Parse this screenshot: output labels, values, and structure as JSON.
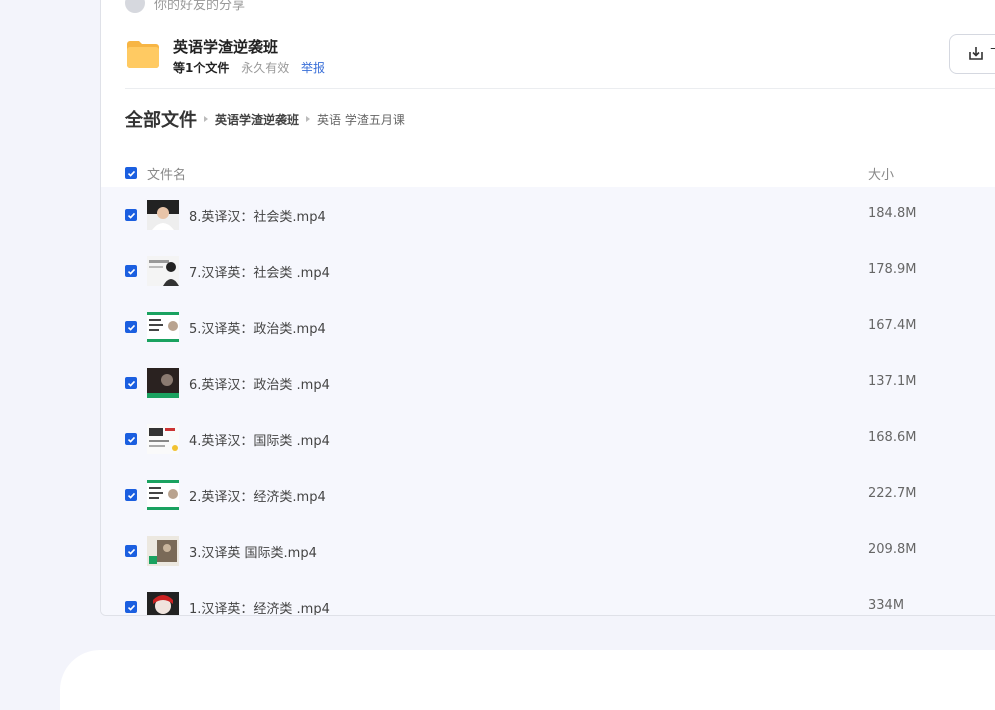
{
  "share": {
    "sharer_text": "你的好友的分享",
    "folder_name": "英语学渣逆袭班",
    "file_count": "等1个文件",
    "validity": "永久有效",
    "report": "举报",
    "download_label": "下"
  },
  "breadcrumb": {
    "root": "全部文件",
    "level1": "英语学渣逆袭班",
    "level2": "英语 学渣五月课"
  },
  "table": {
    "col_name": "文件名",
    "col_size": "大小"
  },
  "files": [
    {
      "name": "8.英译汉：社会类.mp4",
      "size": "184.8M",
      "thumb": "person-dark"
    },
    {
      "name": "7.汉译英：社会类 .mp4",
      "size": "178.9M",
      "thumb": "person-light"
    },
    {
      "name": "5.汉译英：政治类.mp4",
      "size": "167.4M",
      "thumb": "slide-green"
    },
    {
      "name": "6.英译汉：政治类 .mp4",
      "size": "137.1M",
      "thumb": "dark-green-bar"
    },
    {
      "name": "4.英译汉：国际类 .mp4",
      "size": "168.6M",
      "thumb": "doc-light"
    },
    {
      "name": "2.英译汉：经济类.mp4",
      "size": "222.7M",
      "thumb": "slide-green"
    },
    {
      "name": "3.汉译英 国际类.mp4",
      "size": "209.8M",
      "thumb": "photo-mixed"
    },
    {
      "name": "1.汉译英：经济类 .mp4",
      "size": "334M",
      "thumb": "person-opera"
    }
  ],
  "colors": {
    "accent": "#1b5fe0",
    "link": "#3a6fd8",
    "list_bg": "#f6f7fd",
    "page_bg": "#f3f4fb",
    "folder": "#ffca62"
  }
}
